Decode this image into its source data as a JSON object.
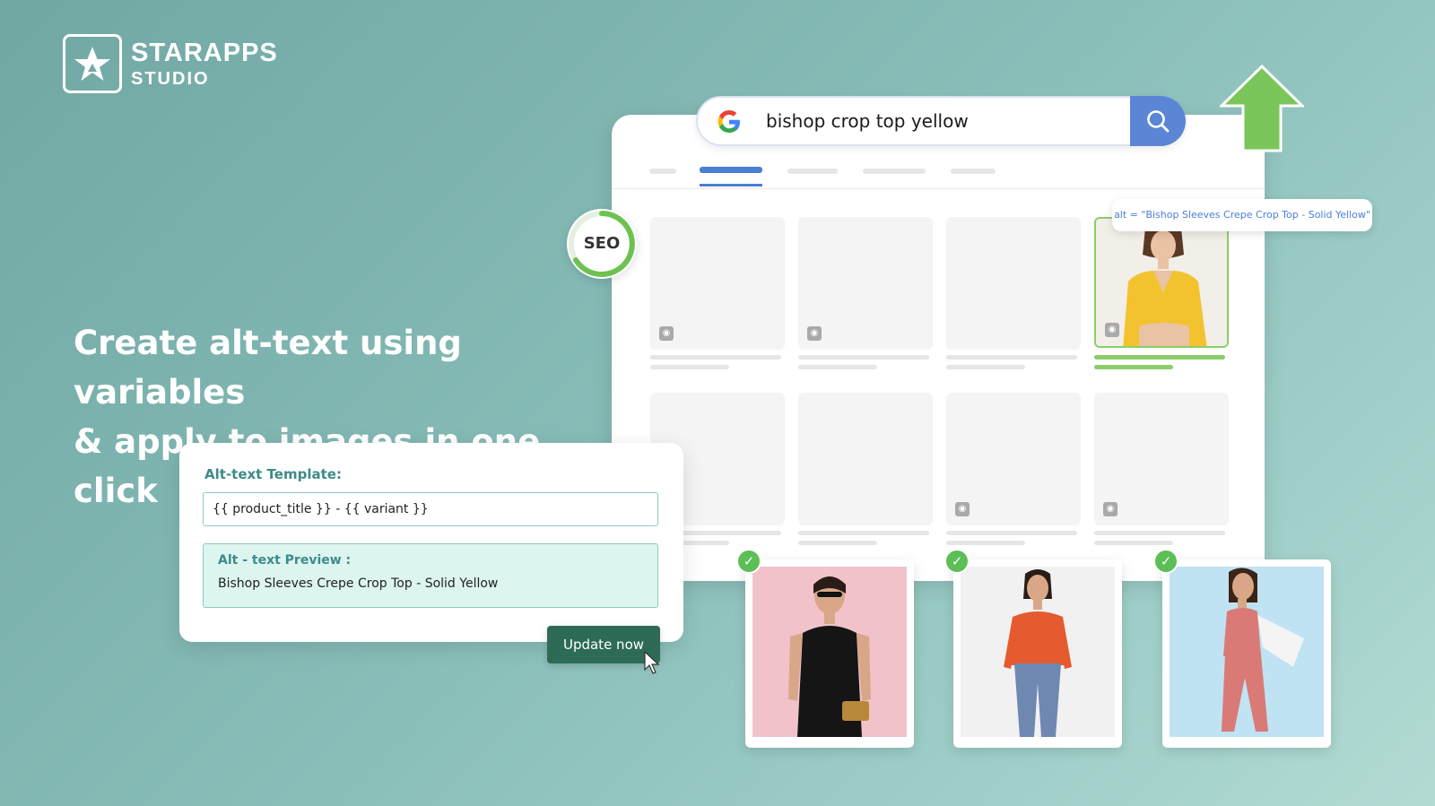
{
  "brand": {
    "name": "STARAPPS",
    "sub": "STUDIO"
  },
  "headline": {
    "line1": "Create alt-text using variables",
    "line2": "& apply to images in one click"
  },
  "search": {
    "query": "bishop crop top yellow"
  },
  "seo_badge": {
    "label": "SEO"
  },
  "alt_tooltip": {
    "text": "alt = \"Bishop Sleeves Crepe Crop Top - Solid Yellow\""
  },
  "template_panel": {
    "label": "Alt-text Template:",
    "template_value": "{{ product_title }} - {{ variant }}",
    "preview_label": "Alt - text Preview :",
    "preview_value": "Bishop Sleeves Crepe Crop Top - Solid Yellow",
    "update_label": "Update now"
  },
  "icons": {
    "logo": "star-logo-icon",
    "google": "google-g-icon",
    "search": "magnifier-icon",
    "up": "up-arrow-icon",
    "check": "check-icon",
    "cursor": "cursor-icon",
    "tag": "tag-icon"
  },
  "colors": {
    "accent_blue": "#5b86d6",
    "accent_green": "#5cbf55",
    "brand_teal": "#3d8b87",
    "button_green": "#2e6b57"
  }
}
